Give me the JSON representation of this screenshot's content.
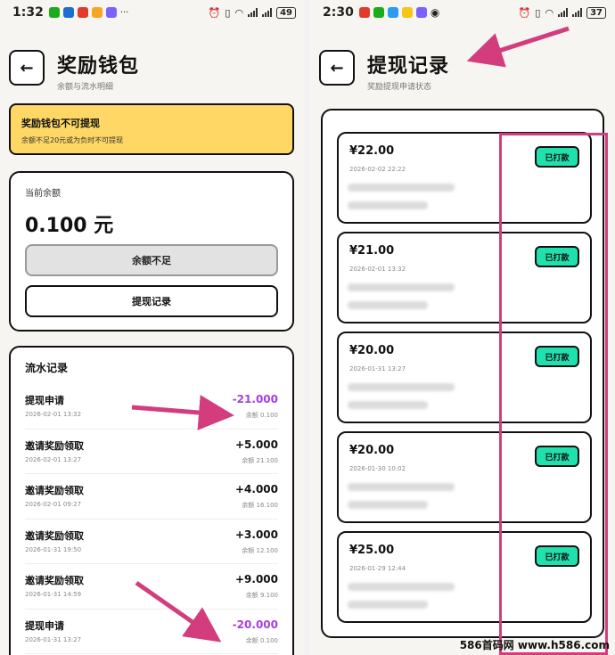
{
  "left": {
    "status": {
      "time": "1:32",
      "battery": "49"
    },
    "header": {
      "title": "奖励钱包",
      "subtitle": "余额与流水明细"
    },
    "warning": {
      "title": "奖励钱包不可提现",
      "desc": "余额不足20元或为负时不可提现"
    },
    "balance": {
      "label": "当前余额",
      "amount": "0.100 元",
      "disabled_button": "余额不足",
      "record_button": "提现记录"
    },
    "flow": {
      "title": "流水记录",
      "rows": [
        {
          "name": "提现申请",
          "date": "2026-02-01 13:32",
          "value": "-21.000",
          "balance": "余额 0.100",
          "negative": true
        },
        {
          "name": "邀请奖励领取",
          "date": "2026-02-01 13:27",
          "value": "+5.000",
          "balance": "余额 21.100",
          "negative": false
        },
        {
          "name": "邀请奖励领取",
          "date": "2026-02-01 09:27",
          "value": "+4.000",
          "balance": "余额 16.100",
          "negative": false
        },
        {
          "name": "邀请奖励领取",
          "date": "2026-01-31 19:50",
          "value": "+3.000",
          "balance": "余额 12.100",
          "negative": false
        },
        {
          "name": "邀请奖励领取",
          "date": "2026-01-31 14:59",
          "value": "+9.000",
          "balance": "余额 9.100",
          "negative": false
        },
        {
          "name": "提现申请",
          "date": "2026-01-31 13:27",
          "value": "-20.000",
          "balance": "余额 0.100",
          "negative": true
        }
      ]
    }
  },
  "right": {
    "status": {
      "time": "2:30",
      "battery": "37"
    },
    "header": {
      "title": "提现记录",
      "subtitle": "奖励提现申请状态"
    },
    "records": [
      {
        "amount": "¥22.00",
        "time": "2026-02-02 22:22",
        "status": "已打款"
      },
      {
        "amount": "¥21.00",
        "time": "2026-02-01 13:32",
        "status": "已打款"
      },
      {
        "amount": "¥20.00",
        "time": "2026-01-31 13:27",
        "status": "已打款"
      },
      {
        "amount": "¥20.00",
        "time": "2026-01-30 10:02",
        "status": "已打款"
      },
      {
        "amount": "¥25.00",
        "time": "2026-01-29 12:44",
        "status": "已打款"
      }
    ]
  },
  "watermark": "586首码网 www.h586.com",
  "colors": {
    "warning": "#fed765",
    "paid": "#20e0ad",
    "negative": "#a63ee0",
    "annotation": "#d33d7d"
  }
}
